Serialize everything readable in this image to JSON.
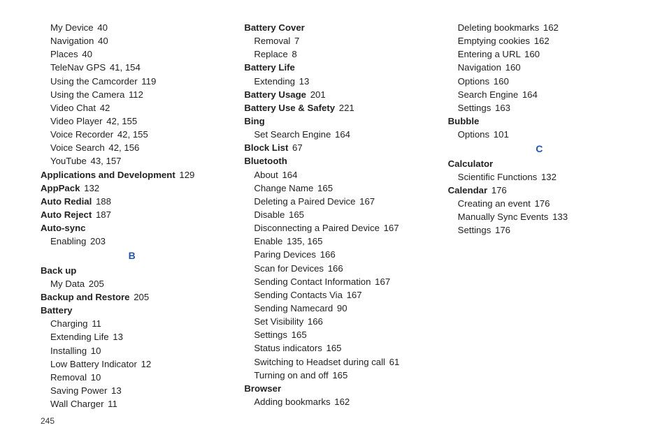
{
  "page_number": "245",
  "entries": [
    {
      "type": "sub",
      "text": "My Device",
      "pages": "40"
    },
    {
      "type": "sub",
      "text": "Navigation",
      "pages": "40"
    },
    {
      "type": "sub",
      "text": "Places",
      "pages": "40"
    },
    {
      "type": "sub",
      "text": "TeleNav GPS",
      "pages": "41, 154"
    },
    {
      "type": "sub",
      "text": "Using the Camcorder",
      "pages": "119"
    },
    {
      "type": "sub",
      "text": "Using the Camera",
      "pages": "112"
    },
    {
      "type": "sub",
      "text": "Video Chat",
      "pages": "42"
    },
    {
      "type": "sub",
      "text": "Video Player",
      "pages": "42, 155"
    },
    {
      "type": "sub",
      "text": "Voice Recorder",
      "pages": "42, 155"
    },
    {
      "type": "sub",
      "text": "Voice Search",
      "pages": "42, 156"
    },
    {
      "type": "sub",
      "text": "YouTube",
      "pages": "43, 157"
    },
    {
      "type": "head",
      "text": "Applications and Development",
      "pages": "129"
    },
    {
      "type": "head",
      "text": "AppPack",
      "pages": "132"
    },
    {
      "type": "head",
      "text": "Auto Redial",
      "pages": "188"
    },
    {
      "type": "head",
      "text": "Auto Reject",
      "pages": "187"
    },
    {
      "type": "head",
      "text": "Auto-sync",
      "pages": ""
    },
    {
      "type": "sub",
      "text": "Enabling",
      "pages": "203"
    },
    {
      "type": "letter",
      "text": "B"
    },
    {
      "type": "head",
      "text": "Back up",
      "pages": ""
    },
    {
      "type": "sub",
      "text": "My Data",
      "pages": "205"
    },
    {
      "type": "head",
      "text": "Backup and Restore",
      "pages": "205"
    },
    {
      "type": "head",
      "text": "Battery",
      "pages": ""
    },
    {
      "type": "sub",
      "text": "Charging",
      "pages": "11"
    },
    {
      "type": "sub",
      "text": "Extending Life",
      "pages": "13"
    },
    {
      "type": "sub",
      "text": "Installing",
      "pages": "10"
    },
    {
      "type": "sub",
      "text": "Low Battery Indicator",
      "pages": "12"
    },
    {
      "type": "sub",
      "text": "Removal",
      "pages": "10"
    },
    {
      "type": "sub",
      "text": "Saving Power",
      "pages": "13"
    },
    {
      "type": "sub",
      "text": "Wall Charger",
      "pages": "11"
    },
    {
      "type": "head",
      "text": "Battery Cover",
      "pages": ""
    },
    {
      "type": "sub",
      "text": "Removal",
      "pages": "7"
    },
    {
      "type": "sub",
      "text": "Replace",
      "pages": "8"
    },
    {
      "type": "head",
      "text": "Battery Life",
      "pages": ""
    },
    {
      "type": "sub",
      "text": "Extending",
      "pages": "13"
    },
    {
      "type": "head",
      "text": "Battery Usage",
      "pages": "201"
    },
    {
      "type": "head",
      "text": "Battery Use & Safety",
      "pages": "221"
    },
    {
      "type": "head",
      "text": "Bing",
      "pages": ""
    },
    {
      "type": "sub",
      "text": "Set Search Engine",
      "pages": "164"
    },
    {
      "type": "head",
      "text": "Block List",
      "pages": "67"
    },
    {
      "type": "head",
      "text": "Bluetooth",
      "pages": ""
    },
    {
      "type": "sub",
      "text": "About",
      "pages": "164"
    },
    {
      "type": "sub",
      "text": "Change Name",
      "pages": "165"
    },
    {
      "type": "sub",
      "text": "Deleting a Paired Device",
      "pages": "167"
    },
    {
      "type": "sub",
      "text": "Disable",
      "pages": "165"
    },
    {
      "type": "sub",
      "text": "Disconnecting a Paired Device",
      "pages": "167"
    },
    {
      "type": "sub",
      "text": "Enable",
      "pages": "135, 165"
    },
    {
      "type": "sub",
      "text": "Paring Devices",
      "pages": "166"
    },
    {
      "type": "sub",
      "text": "Scan for Devices",
      "pages": "166"
    },
    {
      "type": "sub",
      "text": "Sending Contact Information",
      "pages": "167"
    },
    {
      "type": "sub",
      "text": "Sending Contacts Via",
      "pages": "167"
    },
    {
      "type": "sub",
      "text": "Sending Namecard",
      "pages": "90"
    },
    {
      "type": "sub",
      "text": "Set Visibility",
      "pages": "166"
    },
    {
      "type": "sub",
      "text": "Settings",
      "pages": "165"
    },
    {
      "type": "sub",
      "text": "Status indicators",
      "pages": "165"
    },
    {
      "type": "sub",
      "text": "Switching to Headset during call",
      "pages": "61"
    },
    {
      "type": "sub",
      "text": "Turning on and off",
      "pages": "165"
    },
    {
      "type": "head",
      "text": "Browser",
      "pages": ""
    },
    {
      "type": "sub",
      "text": "Adding bookmarks",
      "pages": "162"
    },
    {
      "type": "sub",
      "text": "Deleting bookmarks",
      "pages": "162"
    },
    {
      "type": "sub",
      "text": "Emptying cookies",
      "pages": "162"
    },
    {
      "type": "sub",
      "text": "Entering a URL",
      "pages": "160"
    },
    {
      "type": "sub",
      "text": "Navigation",
      "pages": "160"
    },
    {
      "type": "sub",
      "text": "Options",
      "pages": "160"
    },
    {
      "type": "sub",
      "text": "Search Engine",
      "pages": "164"
    },
    {
      "type": "sub",
      "text": "Settings",
      "pages": "163"
    },
    {
      "type": "head",
      "text": "Bubble",
      "pages": ""
    },
    {
      "type": "sub",
      "text": "Options",
      "pages": "101"
    },
    {
      "type": "letter",
      "text": "C"
    },
    {
      "type": "head",
      "text": "Calculator",
      "pages": ""
    },
    {
      "type": "sub",
      "text": "Scientific Functions",
      "pages": "132"
    },
    {
      "type": "head",
      "text": "Calendar",
      "pages": "176"
    },
    {
      "type": "sub",
      "text": "Creating an event",
      "pages": "176"
    },
    {
      "type": "sub",
      "text": "Manually Sync Events",
      "pages": "133"
    },
    {
      "type": "sub",
      "text": "Settings",
      "pages": "176"
    }
  ]
}
